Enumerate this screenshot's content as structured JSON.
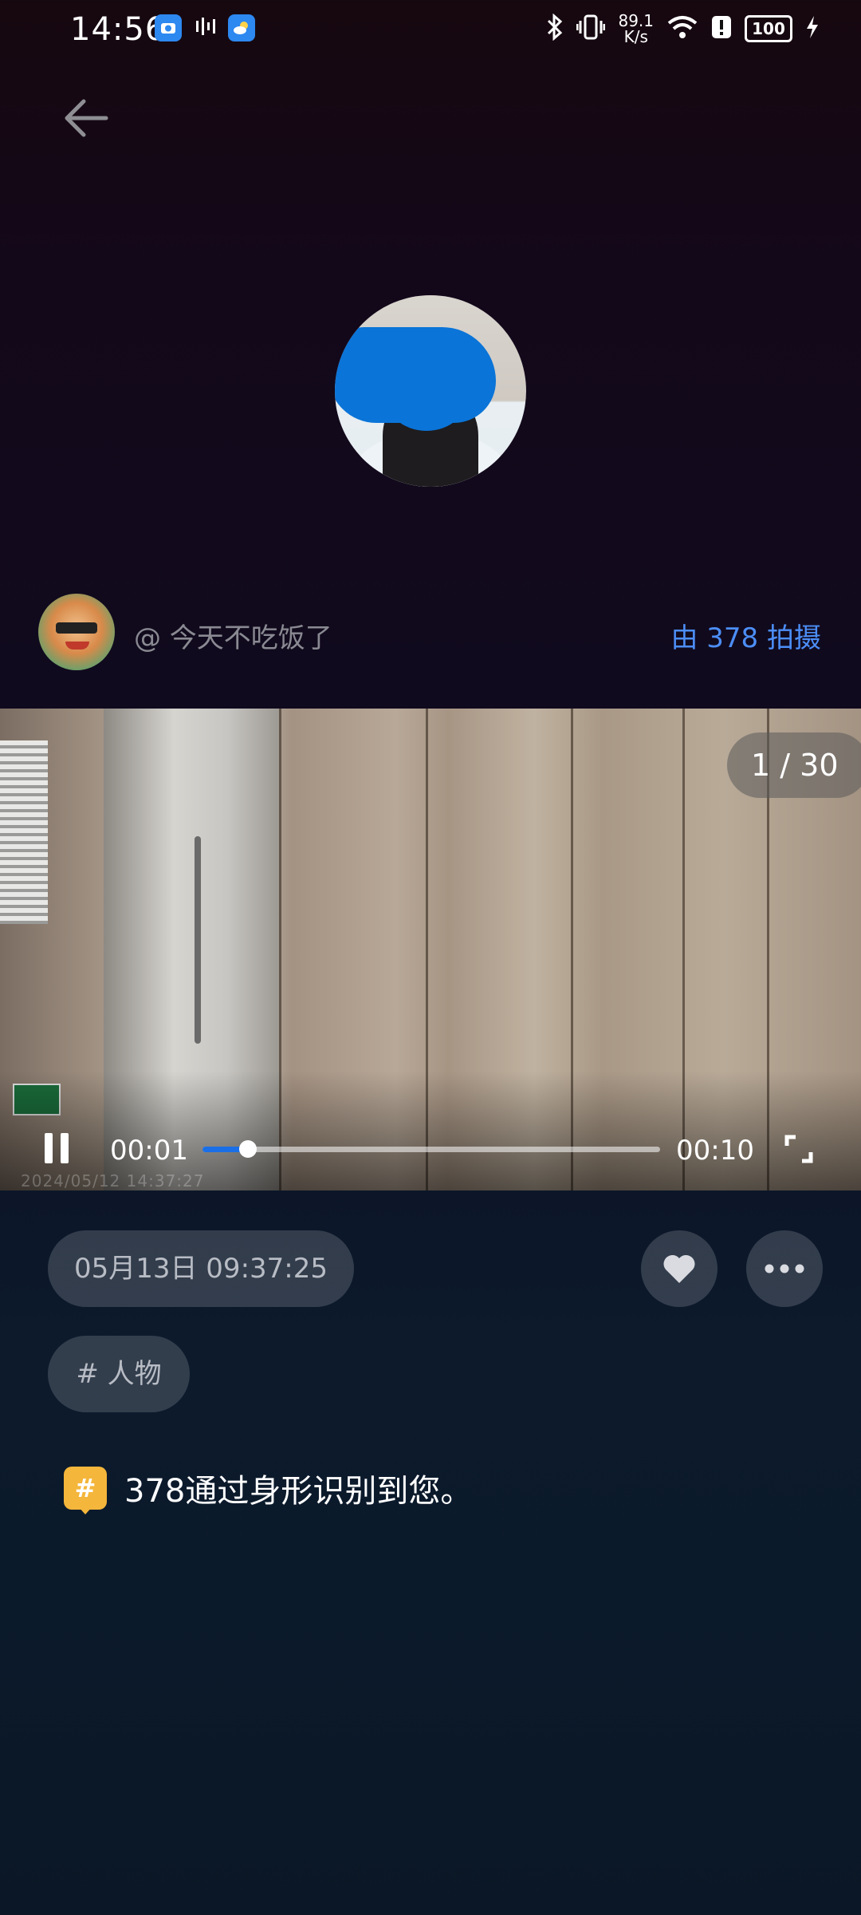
{
  "status_bar": {
    "time": "14:56",
    "net_speed_value": "89.1",
    "net_speed_unit": "K/s",
    "battery": "100"
  },
  "author": {
    "name": "@ 今天不吃饭了",
    "shot_by": "由 378 拍摄"
  },
  "video": {
    "page_counter": "1 / 30",
    "current_time": "00:01",
    "total_time": "00:10",
    "progress": 0.1,
    "watermark": "2024/05/12  14:37:27"
  },
  "detail": {
    "date": "05月13日 09:37:25",
    "tag": "# 人物",
    "note_icon": "#",
    "note": "378通过身形识别到您。"
  },
  "colors": {
    "accent": "#4c8ef7",
    "progress": "#1a6fe6",
    "note_icon_bg": "#f4b63b"
  }
}
